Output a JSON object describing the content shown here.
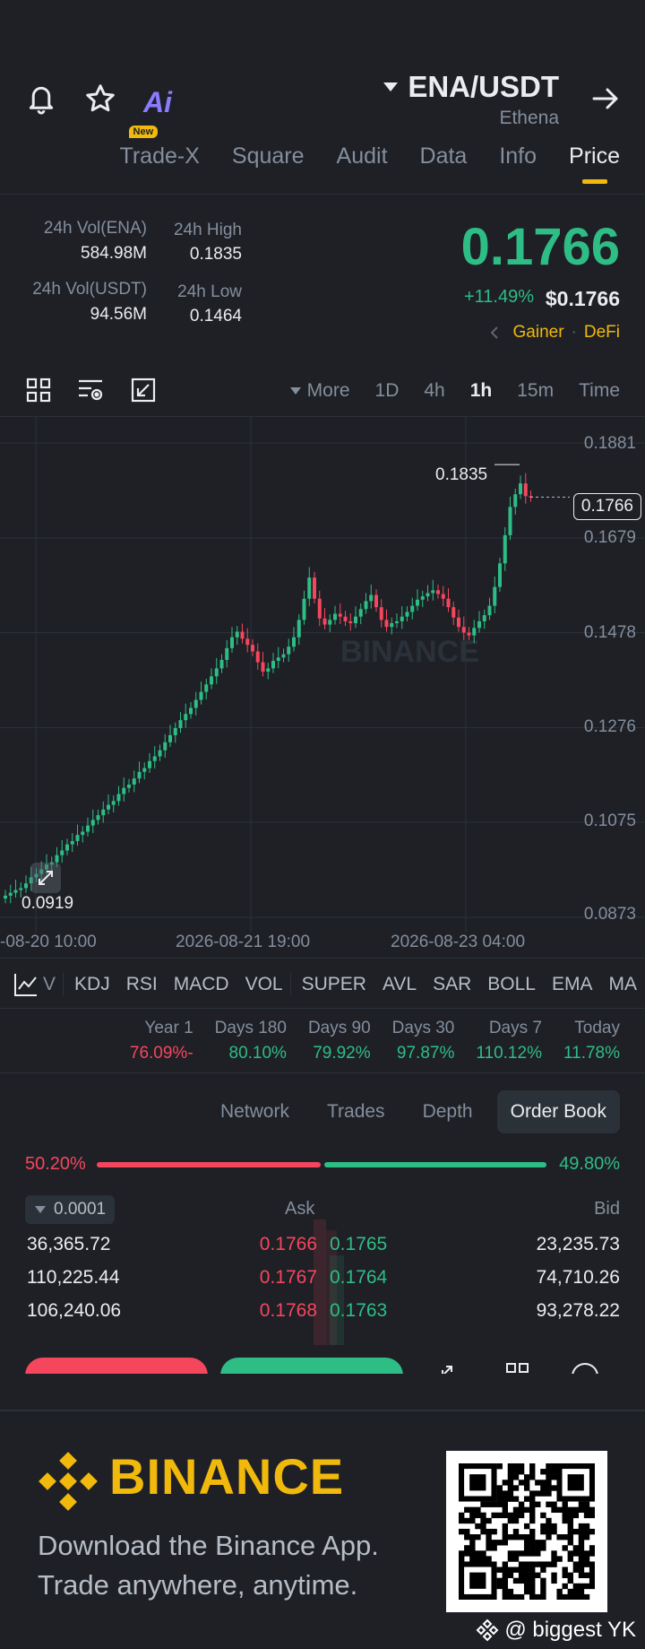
{
  "header": {
    "pair": "ENA/USDT",
    "subtitle": "Ethena",
    "ai_label": "Ai"
  },
  "tabs": [
    {
      "label": "Trade-X",
      "badge": "New"
    },
    {
      "label": "Square"
    },
    {
      "label": "Audit"
    },
    {
      "label": "Data"
    },
    {
      "label": "Info"
    },
    {
      "label": "Price",
      "active": true
    }
  ],
  "stats": {
    "vol_ena_label": "24h Vol(ENA)",
    "vol_ena": "584.98M",
    "vol_usdt_label": "24h Vol(USDT)",
    "vol_usdt": "94.56M",
    "high_label": "24h High",
    "high": "0.1835",
    "low_label": "24h Low",
    "low": "0.1464"
  },
  "price": {
    "last": "0.1766",
    "change": "+11.49%",
    "usd": "$0.1766",
    "tag1": "Gainer",
    "tag2": "DeFi"
  },
  "timeframes": {
    "more": "More",
    "items": [
      "1D",
      "4h",
      "1h",
      "15m",
      "Time"
    ],
    "active": "1h"
  },
  "chart": {
    "y_ticks": [
      "0.1881",
      "0.1679",
      "0.1478",
      "0.1276",
      "0.1075",
      "0.0873"
    ],
    "x_ticks": [
      "-08-20 10:00",
      "2026-08-21 19:00",
      "2026-08-23 04:00"
    ],
    "high_marker": "0.1835",
    "low_marker": "0.0919",
    "current_tag": "0.1766",
    "watermark": "BINANCE"
  },
  "chart_data": {
    "type": "candlestick",
    "ylim": [
      0.0873,
      0.1881
    ],
    "y_ticks": [
      0.1881,
      0.1679,
      0.1478,
      0.1276,
      0.1075,
      0.0873
    ],
    "close_series_estimated": [
      0.0919,
      0.0925,
      0.0931,
      0.0935,
      0.0945,
      0.0958,
      0.0965,
      0.0975,
      0.0985,
      0.099,
      0.1005,
      0.1015,
      0.1028,
      0.1035,
      0.1048,
      0.1055,
      0.1068,
      0.108,
      0.109,
      0.1102,
      0.1112,
      0.112,
      0.1135,
      0.1148,
      0.1155,
      0.1168,
      0.1182,
      0.119,
      0.1205,
      0.1215,
      0.1228,
      0.1245,
      0.126,
      0.1275,
      0.1292,
      0.1305,
      0.1318,
      0.1335,
      0.1352,
      0.1368,
      0.1385,
      0.1402,
      0.142,
      0.1445,
      0.1468,
      0.148,
      0.1465,
      0.1452,
      0.1438,
      0.1415,
      0.1395,
      0.1402,
      0.1418,
      0.1425,
      0.1432,
      0.1448,
      0.1468,
      0.1505,
      0.155,
      0.1595,
      0.155,
      0.1508,
      0.1495,
      0.1505,
      0.1518,
      0.1512,
      0.1502,
      0.1498,
      0.1512,
      0.1528,
      0.1545,
      0.1558,
      0.1532,
      0.1505,
      0.149,
      0.1498,
      0.1502,
      0.1512,
      0.1522,
      0.1535,
      0.1548,
      0.1555,
      0.1562,
      0.1568,
      0.156,
      0.155,
      0.1532,
      0.151,
      0.149,
      0.1478,
      0.1472,
      0.1488,
      0.1502,
      0.1515,
      0.1535,
      0.1575,
      0.1625,
      0.1685,
      0.1745,
      0.1772,
      0.1795,
      0.1768,
      0.1766
    ]
  },
  "indicators": [
    "V",
    "KDJ",
    "RSI",
    "MACD",
    "VOL",
    "SUPER",
    "AVL",
    "SAR",
    "BOLL",
    "EMA",
    "MA"
  ],
  "performance": [
    {
      "label": "Year 1",
      "value": "76.09%-",
      "color": "#f6465d"
    },
    {
      "label": "Days 180",
      "value": "80.10%",
      "color": "#2ebd85"
    },
    {
      "label": "Days 90",
      "value": "79.92%",
      "color": "#2ebd85"
    },
    {
      "label": "Days 30",
      "value": "97.87%",
      "color": "#2ebd85"
    },
    {
      "label": "Days 7",
      "value": "110.12%",
      "color": "#2ebd85"
    },
    {
      "label": "Today",
      "value": "11.78%",
      "color": "#2ebd85"
    }
  ],
  "orderbook": {
    "tabs": [
      "Network",
      "Trades",
      "Depth",
      "Order Book"
    ],
    "active": "Order Book",
    "sell_pct": "50.20%",
    "buy_pct": "49.80%",
    "sell_ratio": 0.502,
    "precision": "0.0001",
    "ask_label": "Ask",
    "bid_label": "Bid",
    "rows": [
      {
        "ask_qty": "36,365.72",
        "ask": "0.1766",
        "bid": "0.1765",
        "bid_qty": "23,235.73"
      },
      {
        "ask_qty": "110,225.44",
        "ask": "0.1767",
        "bid": "0.1764",
        "bid_qty": "74,710.26"
      },
      {
        "ask_qty": "106,240.06",
        "ask": "0.1768",
        "bid": "0.1763",
        "bid_qty": "93,278.22"
      }
    ]
  },
  "footer": {
    "brand": "BINANCE",
    "line1": "Download the Binance App.",
    "line2": "Trade anywhere, anytime.",
    "handle": "@ biggest YK"
  },
  "colors": {
    "up": "#2ebd85",
    "down": "#f6465d",
    "accent": "#f0b90b",
    "bg": "#1e2026"
  }
}
